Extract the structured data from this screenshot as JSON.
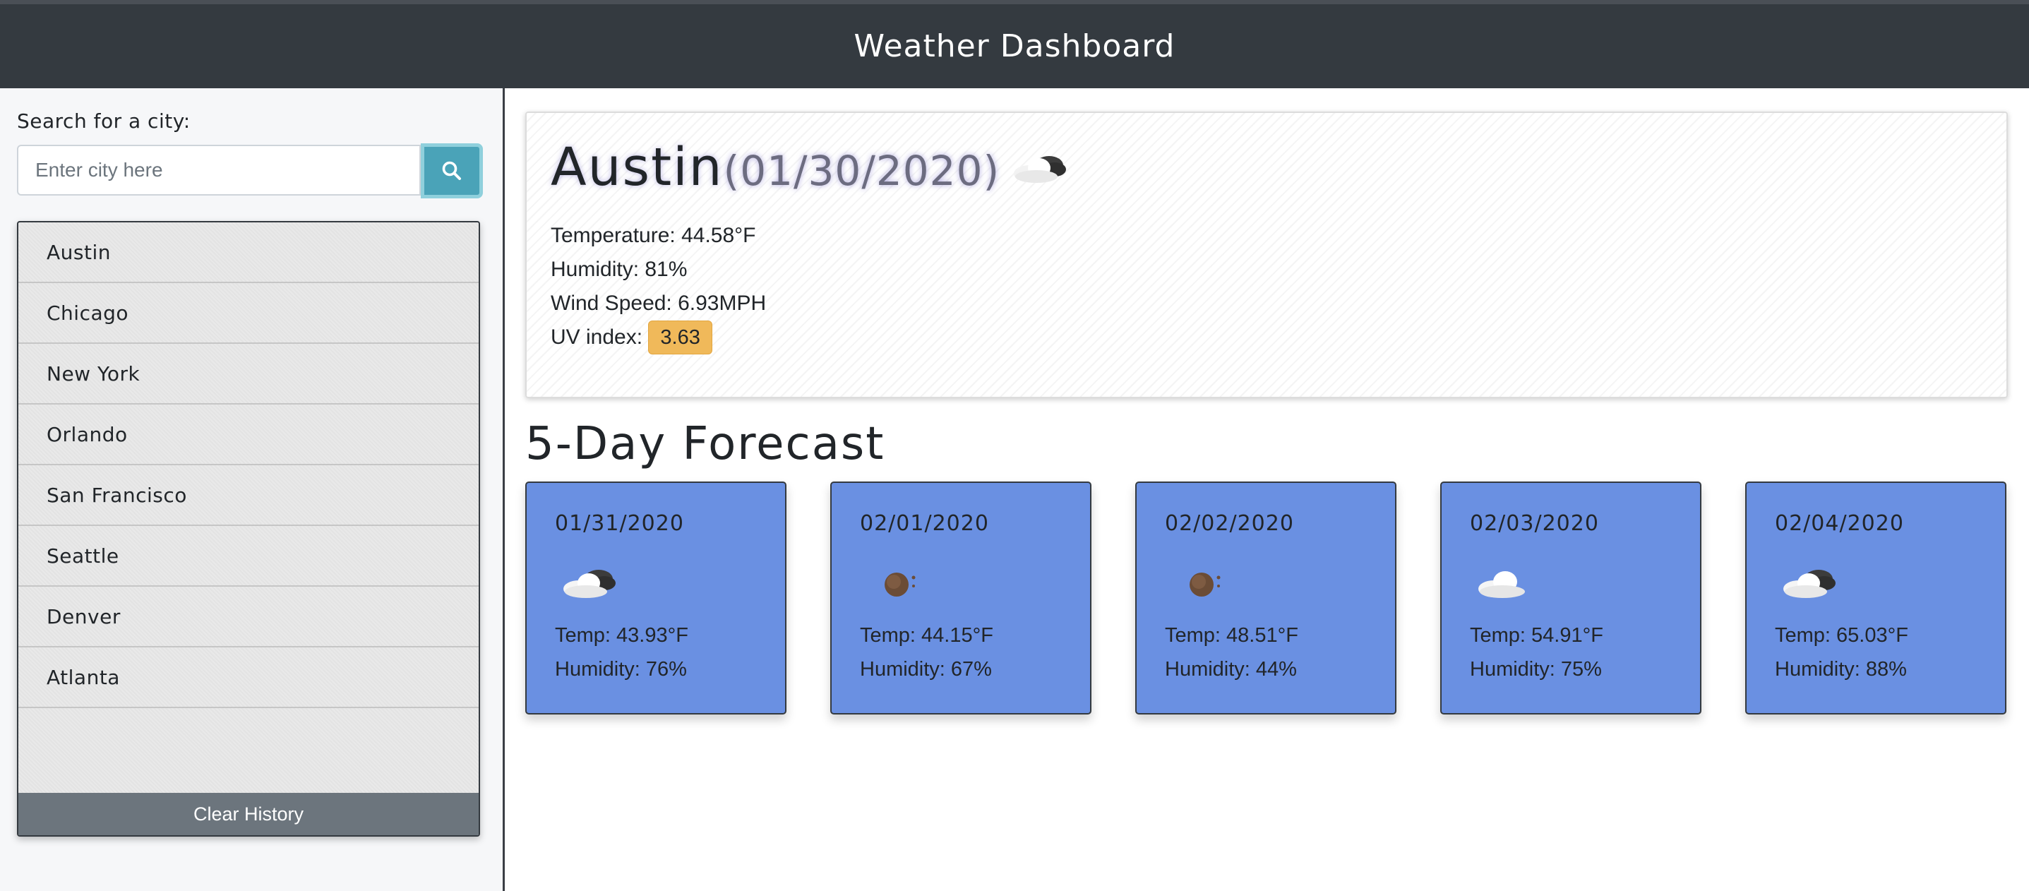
{
  "header": {
    "title": "Weather Dashboard"
  },
  "sidebar": {
    "search_label": "Search for a city:",
    "search_placeholder": "Enter city here",
    "history": [
      "Austin",
      "Chicago",
      "New York",
      "Orlando",
      "San Francisco",
      "Seattle",
      "Denver",
      "Atlanta"
    ],
    "clear_label": "Clear History"
  },
  "current": {
    "city": "Austin",
    "date": "(01/30/2020)",
    "icon": "partly-cloudy-icon",
    "temperature": "Temperature: 44.58°F",
    "humidity": "Humidity: 81%",
    "wind": "Wind Speed: 6.93MPH",
    "uv_label": "UV index:",
    "uv_value": "3.63"
  },
  "forecast": {
    "title": "5-Day Forecast",
    "days": [
      {
        "date": "01/31/2020",
        "icon": "partly-cloudy-icon",
        "temp": "Temp: 43.93°F",
        "humidity": "Humidity: 76%"
      },
      {
        "date": "02/01/2020",
        "icon": "clear-night-icon",
        "temp": "Temp: 44.15°F",
        "humidity": "Humidity: 67%"
      },
      {
        "date": "02/02/2020",
        "icon": "clear-night-icon",
        "temp": "Temp: 48.51°F",
        "humidity": "Humidity: 44%"
      },
      {
        "date": "02/03/2020",
        "icon": "cloud-icon",
        "temp": "Temp: 54.91°F",
        "humidity": "Humidity: 75%"
      },
      {
        "date": "02/04/2020",
        "icon": "partly-cloudy-icon",
        "temp": "Temp: 65.03°F",
        "humidity": "Humidity: 88%"
      }
    ]
  },
  "colors": {
    "header_bg": "#343a40",
    "search_button": "#4aa3b8",
    "card_bg": "#6a90e2",
    "uv_badge": "#f0b95a",
    "clear_button": "#6c757d"
  }
}
